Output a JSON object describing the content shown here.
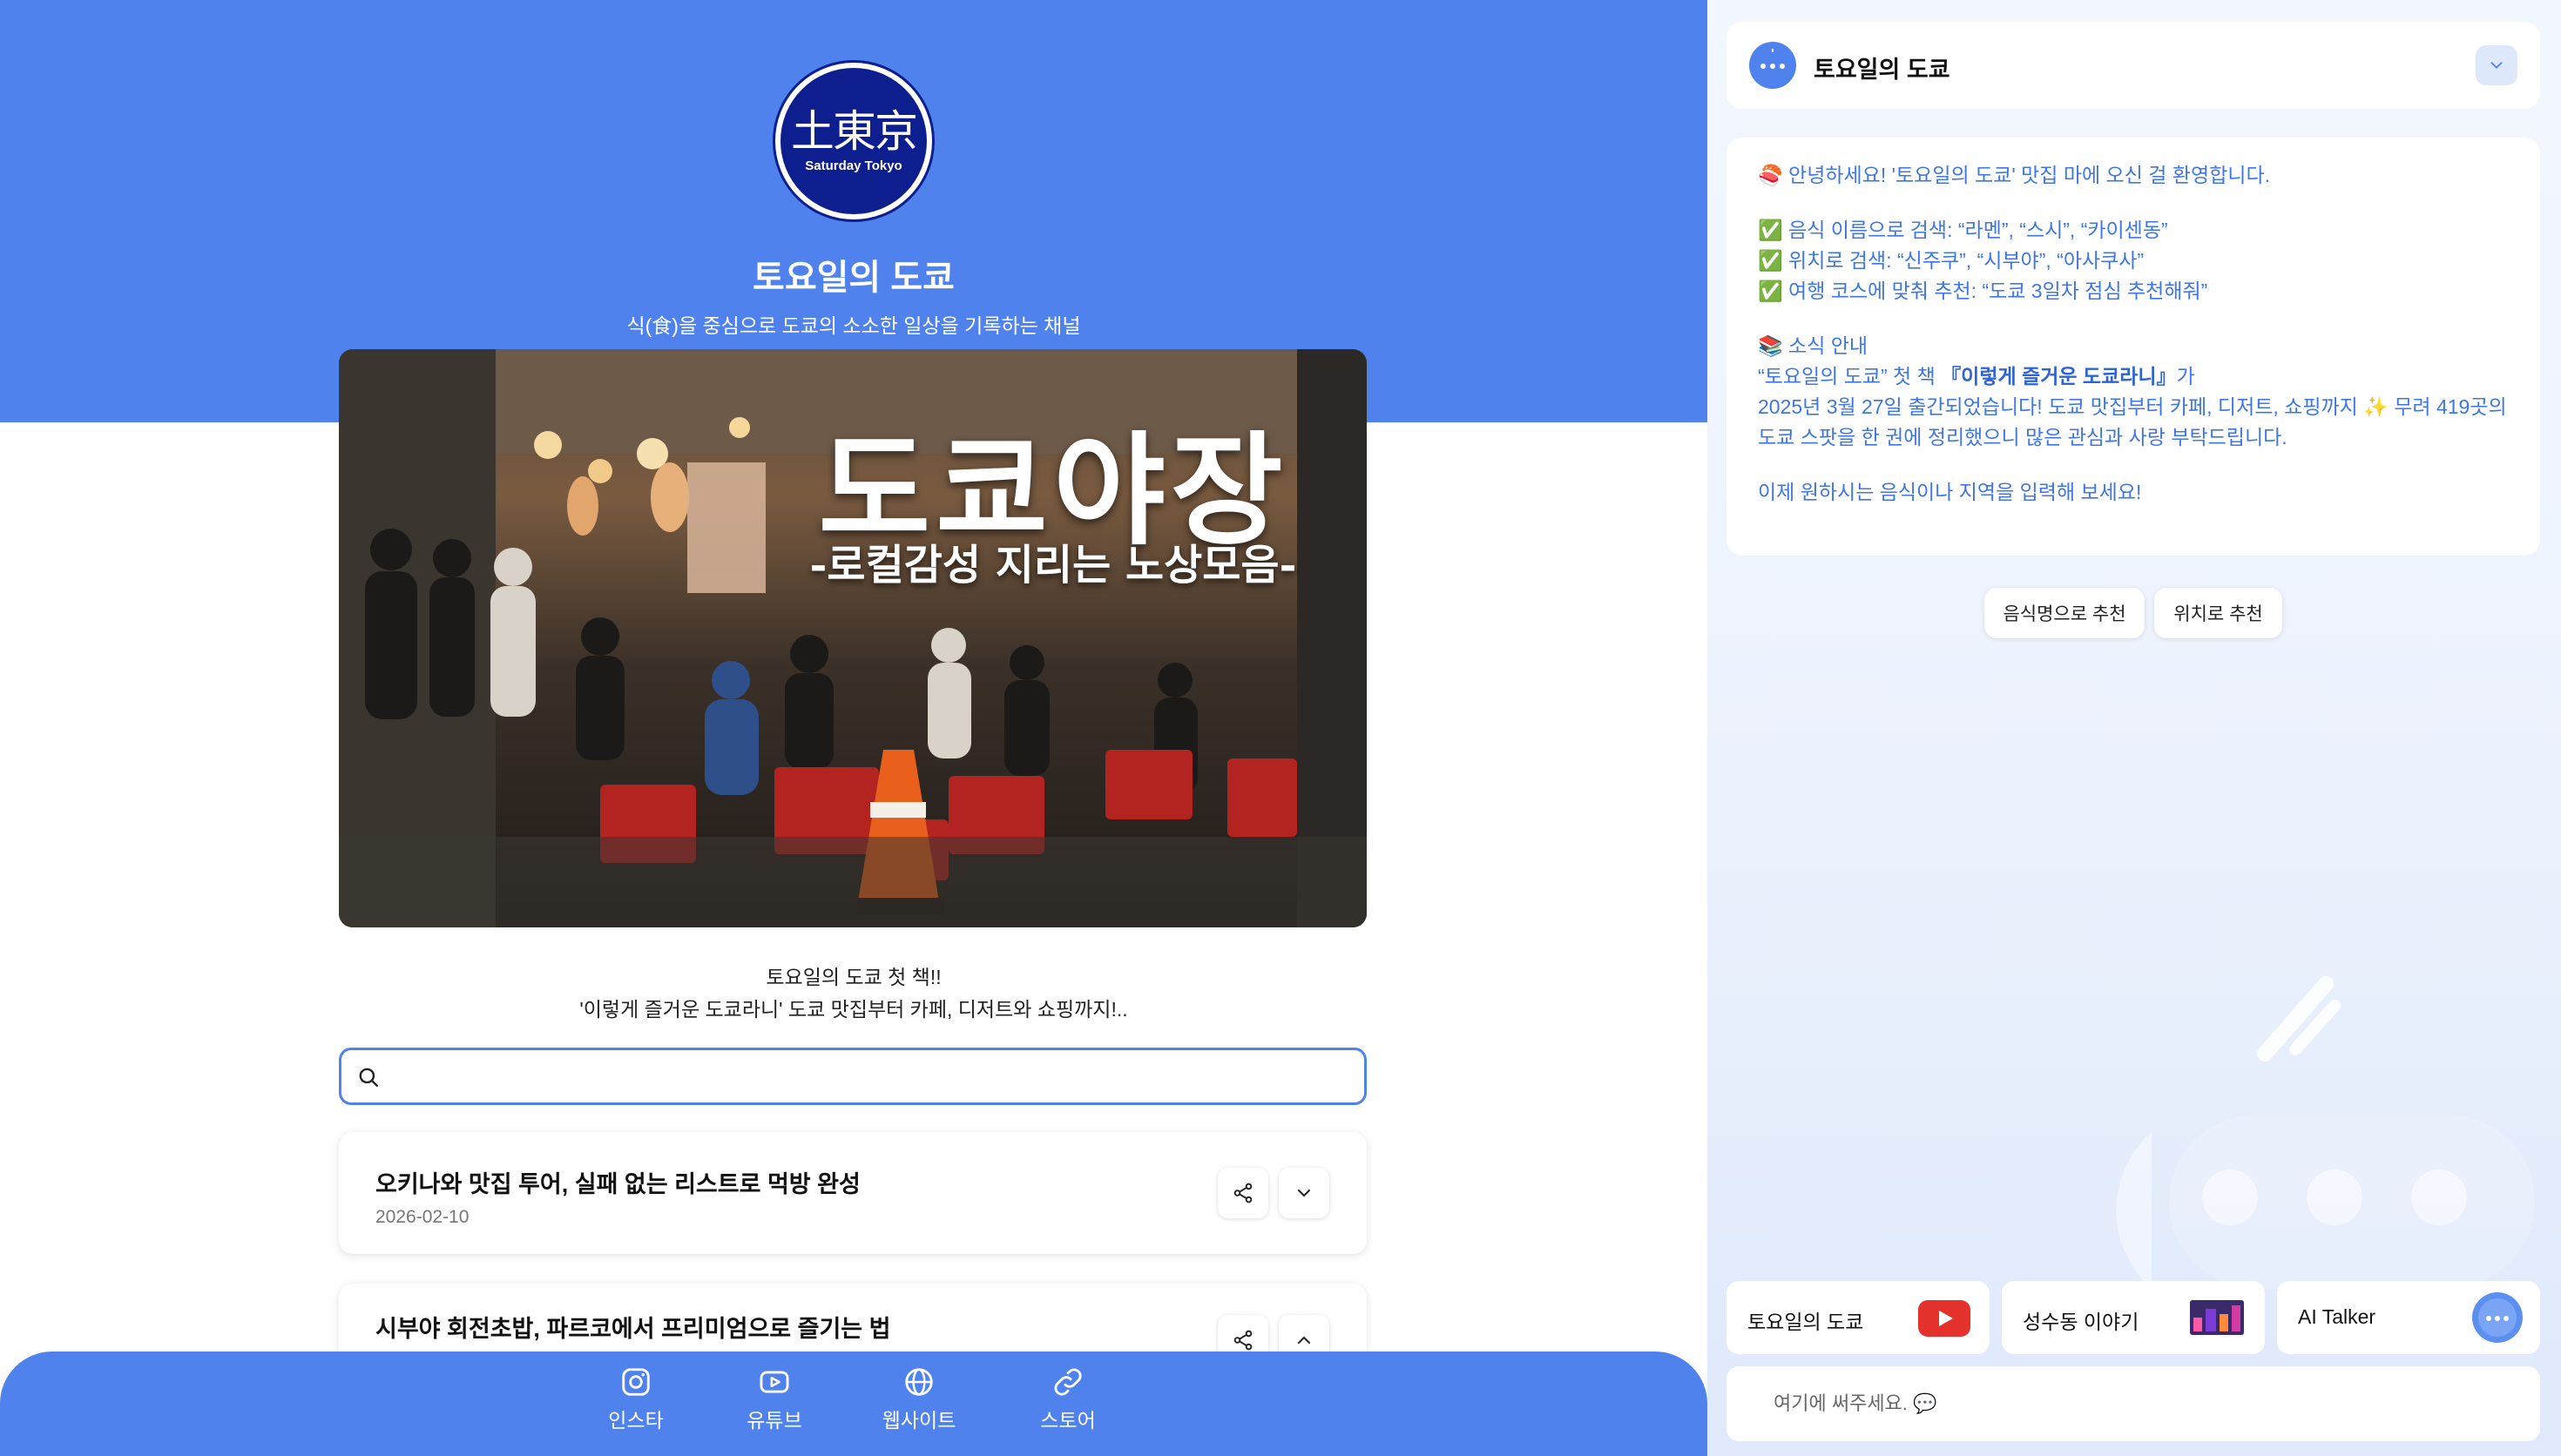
{
  "channel": {
    "logo_kanji": "土東京",
    "logo_english": "Saturday Tokyo",
    "title": "토요일의 도쿄",
    "subtitle": "식(食)을 중심으로 도쿄의 소소한 일상을 기록하는 채널"
  },
  "banner": {
    "title": "도쿄야장",
    "subtitle": "-로컬감성 지리는 노상모음-"
  },
  "book_promo": {
    "line1": "토요일의 도쿄 첫 책!!",
    "line2": "'이렇게 즐거운 도쿄라니' 도쿄 맛집부터 카페, 디저트와 쇼핑까지!.."
  },
  "search": {
    "placeholder": "",
    "value": ""
  },
  "posts": [
    {
      "title": "오키나와 맛집 투어, 실패 없는 리스트로 먹방 완성",
      "date": "2026-02-10"
    },
    {
      "title": "시부야 회전초밥, 파르코에서 프리미엄으로 즐기는 법",
      "date": ""
    }
  ],
  "bottom_nav": [
    {
      "label": "인스타",
      "icon": "instagram-icon"
    },
    {
      "label": "유튜브",
      "icon": "youtube-icon"
    },
    {
      "label": "웹사이트",
      "icon": "globe-icon"
    },
    {
      "label": "스토어",
      "icon": "link-icon"
    }
  ],
  "chat": {
    "bot_name": "토요일의 도쿄",
    "message": {
      "greeting": "🍣 안녕하세요! '토요일의 도쿄' 맛집 마에 오신 걸 환영합니다.",
      "examples": [
        "✅ 음식 이름으로 검색: “라멘”, “스시”, “카이센동”",
        "✅ 위치로 검색: “신주쿠”, “시부야”, “아사쿠사”",
        "✅ 여행 코스에 맞춰 추천: “도쿄 3일차 점심 추천해줘”"
      ],
      "news_heading": "📚 소식 안내",
      "news_line1_prefix": "“토요일의 도쿄” 첫 책 ",
      "news_book": "『이렇게 즐거운 도쿄라니』",
      "news_line1_suffix": "가",
      "news_line2": "2025년 3월 27일 출간되었습니다! 도쿄 맛집부터 카페, 디저트, 쇼핑까지 ✨ 무려 419곳의 도쿄 스팟을 한 권에 정리했으니 많은 관심과 사랑 부탁드립니다.",
      "prompt": "이제 원하시는 음식이나 지역을 입력해 보세요!"
    },
    "quick_replies": [
      "음식명으로 추천",
      "위치로 추천"
    ],
    "shortcut_tiles": [
      {
        "label": "토요일의 도쿄",
        "icon": "youtube-logo-icon"
      },
      {
        "label": "성수동 이야기",
        "icon": "thumbnail-image"
      },
      {
        "label": "AI Talker",
        "icon": "bot-avatar-icon"
      }
    ],
    "input_placeholder": "여기에 써주세요. 💬"
  },
  "colors": {
    "primary": "#4f82ec",
    "logo_navy": "#0d1f8e",
    "youtube_red": "#e5312b",
    "message_text": "#3e76e6"
  }
}
